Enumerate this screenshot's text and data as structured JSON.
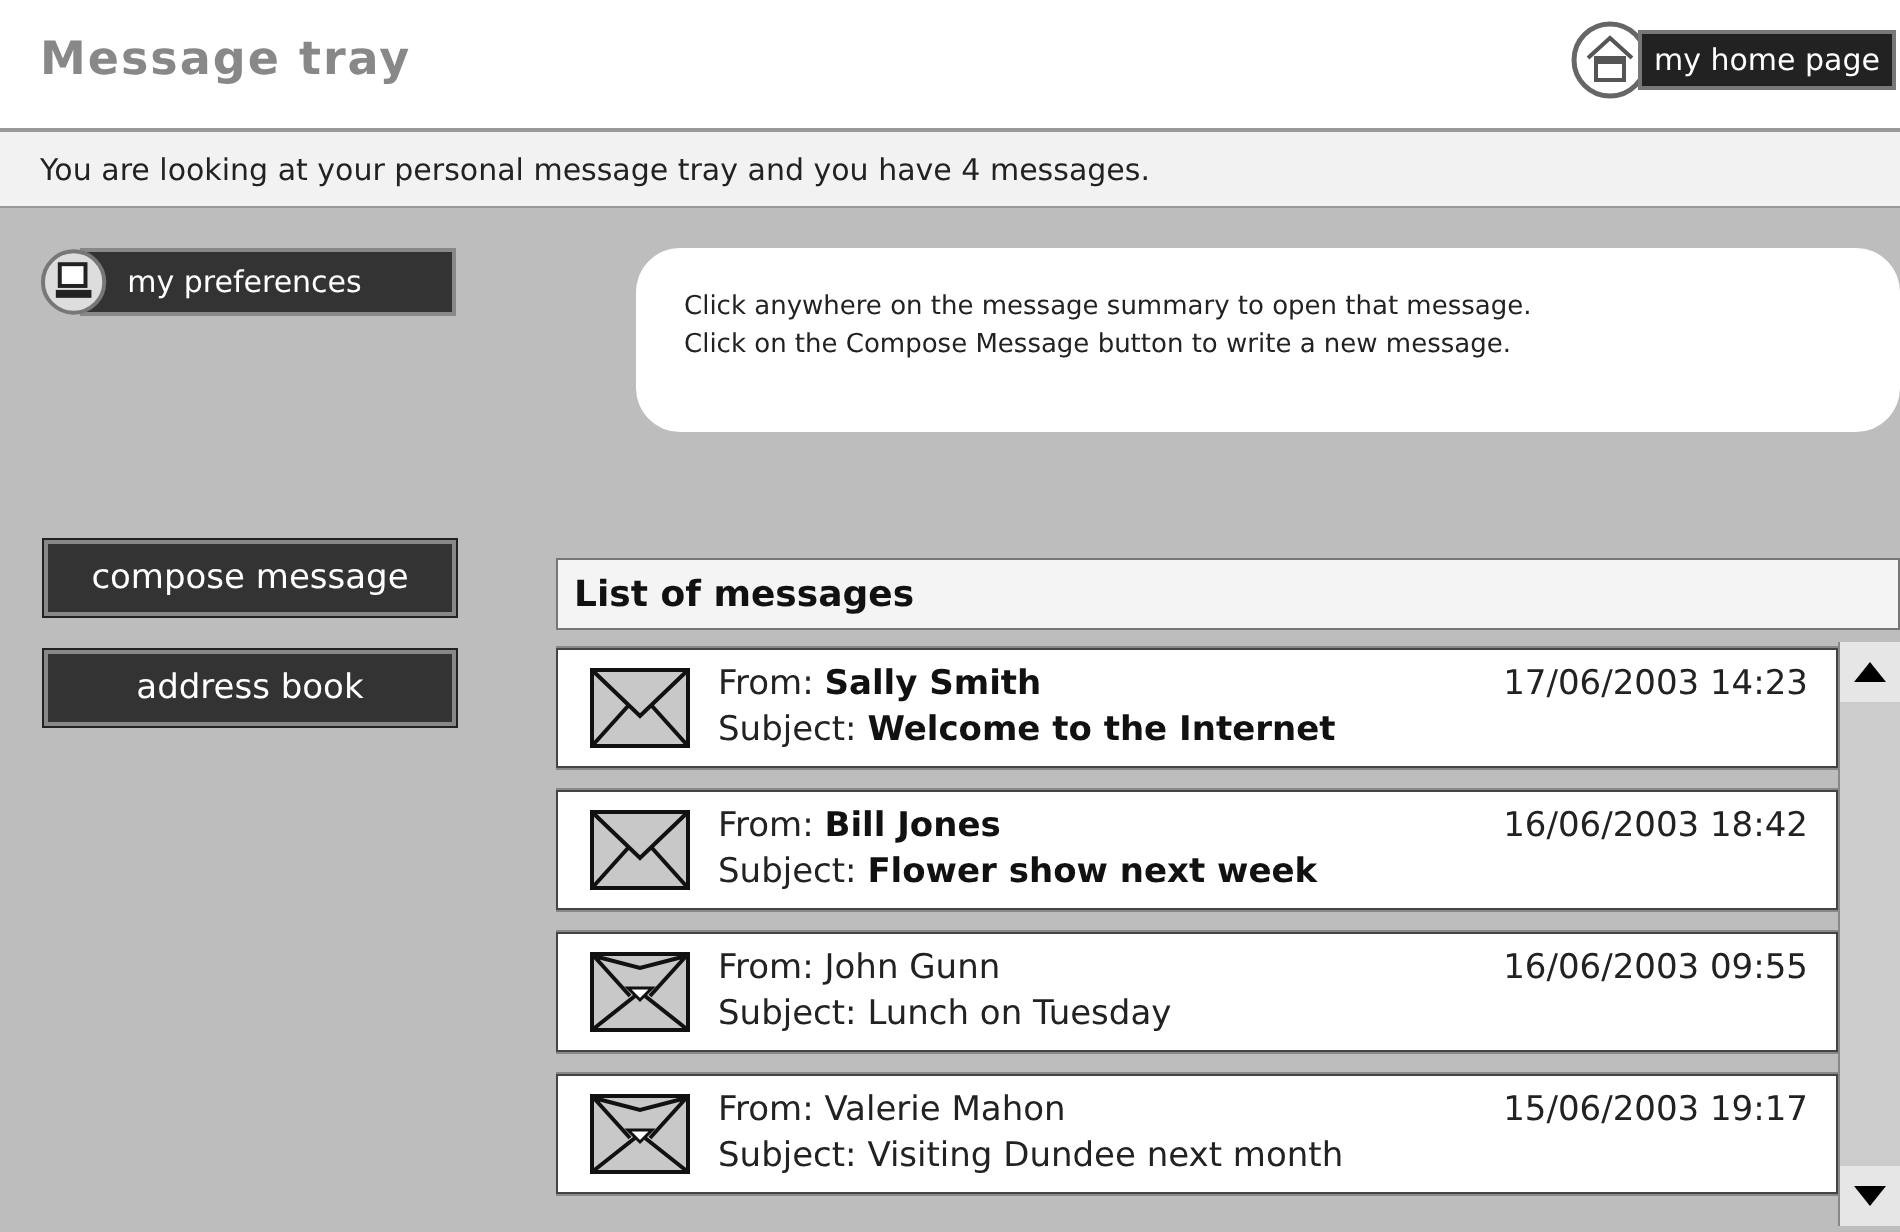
{
  "title": "Message tray",
  "home_button": {
    "label": "my home page"
  },
  "info_bar": "You are looking at your personal message tray and you have 4 messages.",
  "preferences_button": {
    "label": "my preferences"
  },
  "help_bubble": [
    "Click anywhere on the message summary to open that message.",
    "Click on the Compose Message button to write a new message."
  ],
  "actions": [
    {
      "label": "compose message"
    },
    {
      "label": "address book"
    }
  ],
  "message_list": {
    "title": "List of messages",
    "messages": [
      {
        "from_label": "From:",
        "from": "Sally Smith",
        "date": "17/06/2003 14:23",
        "subject_label": "Subject:",
        "subject": "Welcome to the Internet",
        "read": false
      },
      {
        "from_label": "From:",
        "from": "Bill Jones",
        "date": "16/06/2003 18:42",
        "subject_label": "Subject:",
        "subject": "Flower show next week",
        "read": false
      },
      {
        "from_label": "From:",
        "from": "John Gunn",
        "date": "16/06/2003 09:55",
        "subject_label": "Subject:",
        "subject": "Lunch on Tuesday",
        "read": true
      },
      {
        "from_label": "From:",
        "from": "Valerie Mahon",
        "date": "15/06/2003 19:17",
        "subject_label": "Subject:",
        "subject": "Visiting Dundee next month",
        "read": true
      }
    ]
  }
}
